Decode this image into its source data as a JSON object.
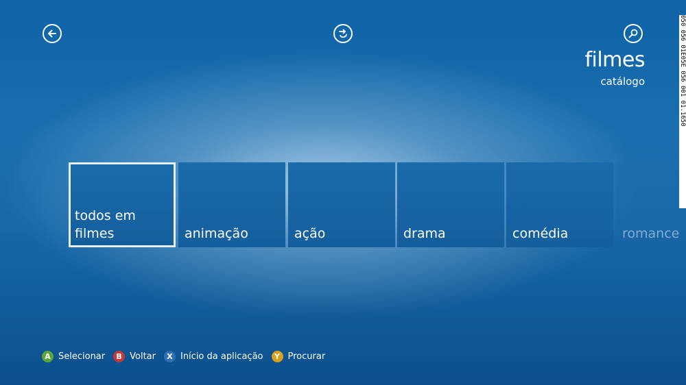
{
  "header": {
    "title": "filmes",
    "subtitle": "catálogo"
  },
  "icons": {
    "back": "arrow-left-icon",
    "refresh": "refresh-icon",
    "search": "magnifier-icon"
  },
  "tiles": [
    {
      "label": "todos em filmes"
    },
    {
      "label": "animação"
    },
    {
      "label": "ação"
    },
    {
      "label": "drama"
    },
    {
      "label": "comédia"
    },
    {
      "label": "romance"
    }
  ],
  "hints": [
    {
      "key": "A",
      "label": "Selecionar",
      "color": "#5aa63c"
    },
    {
      "key": "B",
      "label": "Voltar",
      "color": "#c23b3b"
    },
    {
      "key": "X",
      "label": "Início da aplicação",
      "color": "#2f6db4"
    },
    {
      "key": "Y",
      "label": "Procurar",
      "color": "#d7a11e"
    }
  ],
  "side_strip": {
    "text": "050 056 01E05E 056 001 01.1650"
  }
}
